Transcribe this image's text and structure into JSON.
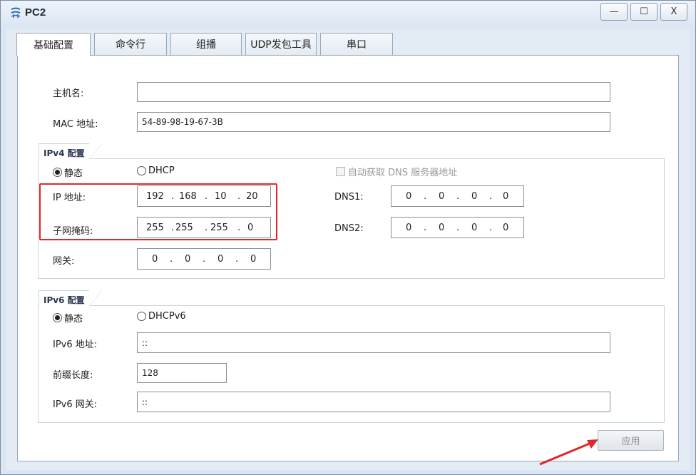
{
  "window": {
    "title": "PC2",
    "minimize_glyph": "—",
    "maximize_glyph": "☐",
    "close_glyph": "X"
  },
  "tabs": [
    {
      "label": "基础配置",
      "active": true
    },
    {
      "label": "命令行",
      "active": false
    },
    {
      "label": "组播",
      "active": false
    },
    {
      "label": "UDP发包工具",
      "active": false
    },
    {
      "label": "串口",
      "active": false
    }
  ],
  "basic": {
    "hostname_label": "主机名:",
    "hostname_value": "",
    "mac_label": "MAC 地址:",
    "mac_value": "54-89-98-19-67-3B"
  },
  "ipv4": {
    "group_title": "IPv4 配置",
    "static_label": "静态",
    "static_selected": true,
    "dhcp_label": "DHCP",
    "auto_dns_label": "自动获取 DNS 服务器地址",
    "ip_label": "IP 地址:",
    "ip": [
      "192",
      "168",
      "10",
      "20"
    ],
    "mask_label": "子网掩码:",
    "mask": [
      "255",
      "255",
      "255",
      "0"
    ],
    "gateway_label": "网关:",
    "gateway": [
      "0",
      "0",
      "0",
      "0"
    ],
    "dns1_label": "DNS1:",
    "dns1": [
      "0",
      "0",
      "0",
      "0"
    ],
    "dns2_label": "DNS2:",
    "dns2": [
      "0",
      "0",
      "0",
      "0"
    ]
  },
  "ipv6": {
    "group_title": "IPv6 配置",
    "static_label": "静态",
    "static_selected": true,
    "dhcp_label": "DHCPv6",
    "addr_label": "IPv6 地址:",
    "addr_value": "::",
    "prefix_label": "前缀长度:",
    "prefix_value": "128",
    "gateway_label": "IPv6 网关:",
    "gateway_value": "::"
  },
  "apply_label": "应用",
  "colors": {
    "highlight": "#e0282c",
    "arrow": "#e0282c"
  }
}
